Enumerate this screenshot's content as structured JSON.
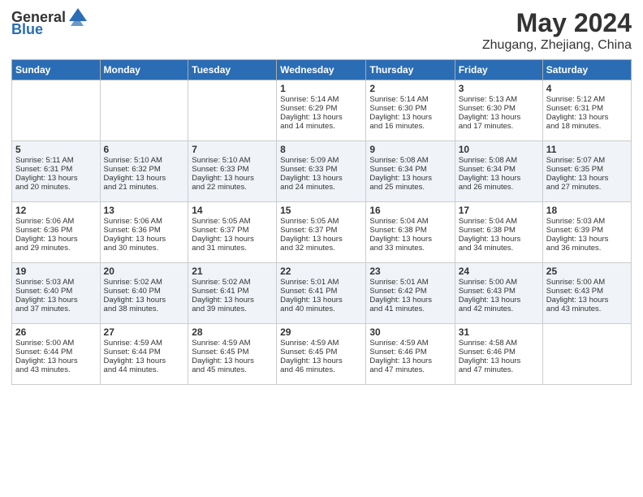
{
  "logo": {
    "general": "General",
    "blue": "Blue"
  },
  "title": {
    "month_year": "May 2024",
    "location": "Zhugang, Zhejiang, China"
  },
  "days_header": [
    "Sunday",
    "Monday",
    "Tuesday",
    "Wednesday",
    "Thursday",
    "Friday",
    "Saturday"
  ],
  "weeks": [
    {
      "cells": [
        {
          "day": "",
          "info": ""
        },
        {
          "day": "",
          "info": ""
        },
        {
          "day": "",
          "info": ""
        },
        {
          "day": "1",
          "info": "Sunrise: 5:14 AM\nSunset: 6:29 PM\nDaylight: 13 hours\nand 14 minutes."
        },
        {
          "day": "2",
          "info": "Sunrise: 5:14 AM\nSunset: 6:30 PM\nDaylight: 13 hours\nand 16 minutes."
        },
        {
          "day": "3",
          "info": "Sunrise: 5:13 AM\nSunset: 6:30 PM\nDaylight: 13 hours\nand 17 minutes."
        },
        {
          "day": "4",
          "info": "Sunrise: 5:12 AM\nSunset: 6:31 PM\nDaylight: 13 hours\nand 18 minutes."
        }
      ]
    },
    {
      "cells": [
        {
          "day": "5",
          "info": "Sunrise: 5:11 AM\nSunset: 6:31 PM\nDaylight: 13 hours\nand 20 minutes."
        },
        {
          "day": "6",
          "info": "Sunrise: 5:10 AM\nSunset: 6:32 PM\nDaylight: 13 hours\nand 21 minutes."
        },
        {
          "day": "7",
          "info": "Sunrise: 5:10 AM\nSunset: 6:33 PM\nDaylight: 13 hours\nand 22 minutes."
        },
        {
          "day": "8",
          "info": "Sunrise: 5:09 AM\nSunset: 6:33 PM\nDaylight: 13 hours\nand 24 minutes."
        },
        {
          "day": "9",
          "info": "Sunrise: 5:08 AM\nSunset: 6:34 PM\nDaylight: 13 hours\nand 25 minutes."
        },
        {
          "day": "10",
          "info": "Sunrise: 5:08 AM\nSunset: 6:34 PM\nDaylight: 13 hours\nand 26 minutes."
        },
        {
          "day": "11",
          "info": "Sunrise: 5:07 AM\nSunset: 6:35 PM\nDaylight: 13 hours\nand 27 minutes."
        }
      ]
    },
    {
      "cells": [
        {
          "day": "12",
          "info": "Sunrise: 5:06 AM\nSunset: 6:36 PM\nDaylight: 13 hours\nand 29 minutes."
        },
        {
          "day": "13",
          "info": "Sunrise: 5:06 AM\nSunset: 6:36 PM\nDaylight: 13 hours\nand 30 minutes."
        },
        {
          "day": "14",
          "info": "Sunrise: 5:05 AM\nSunset: 6:37 PM\nDaylight: 13 hours\nand 31 minutes."
        },
        {
          "day": "15",
          "info": "Sunrise: 5:05 AM\nSunset: 6:37 PM\nDaylight: 13 hours\nand 32 minutes."
        },
        {
          "day": "16",
          "info": "Sunrise: 5:04 AM\nSunset: 6:38 PM\nDaylight: 13 hours\nand 33 minutes."
        },
        {
          "day": "17",
          "info": "Sunrise: 5:04 AM\nSunset: 6:38 PM\nDaylight: 13 hours\nand 34 minutes."
        },
        {
          "day": "18",
          "info": "Sunrise: 5:03 AM\nSunset: 6:39 PM\nDaylight: 13 hours\nand 36 minutes."
        }
      ]
    },
    {
      "cells": [
        {
          "day": "19",
          "info": "Sunrise: 5:03 AM\nSunset: 6:40 PM\nDaylight: 13 hours\nand 37 minutes."
        },
        {
          "day": "20",
          "info": "Sunrise: 5:02 AM\nSunset: 6:40 PM\nDaylight: 13 hours\nand 38 minutes."
        },
        {
          "day": "21",
          "info": "Sunrise: 5:02 AM\nSunset: 6:41 PM\nDaylight: 13 hours\nand 39 minutes."
        },
        {
          "day": "22",
          "info": "Sunrise: 5:01 AM\nSunset: 6:41 PM\nDaylight: 13 hours\nand 40 minutes."
        },
        {
          "day": "23",
          "info": "Sunrise: 5:01 AM\nSunset: 6:42 PM\nDaylight: 13 hours\nand 41 minutes."
        },
        {
          "day": "24",
          "info": "Sunrise: 5:00 AM\nSunset: 6:43 PM\nDaylight: 13 hours\nand 42 minutes."
        },
        {
          "day": "25",
          "info": "Sunrise: 5:00 AM\nSunset: 6:43 PM\nDaylight: 13 hours\nand 43 minutes."
        }
      ]
    },
    {
      "cells": [
        {
          "day": "26",
          "info": "Sunrise: 5:00 AM\nSunset: 6:44 PM\nDaylight: 13 hours\nand 43 minutes."
        },
        {
          "day": "27",
          "info": "Sunrise: 4:59 AM\nSunset: 6:44 PM\nDaylight: 13 hours\nand 44 minutes."
        },
        {
          "day": "28",
          "info": "Sunrise: 4:59 AM\nSunset: 6:45 PM\nDaylight: 13 hours\nand 45 minutes."
        },
        {
          "day": "29",
          "info": "Sunrise: 4:59 AM\nSunset: 6:45 PM\nDaylight: 13 hours\nand 46 minutes."
        },
        {
          "day": "30",
          "info": "Sunrise: 4:59 AM\nSunset: 6:46 PM\nDaylight: 13 hours\nand 47 minutes."
        },
        {
          "day": "31",
          "info": "Sunrise: 4:58 AM\nSunset: 6:46 PM\nDaylight: 13 hours\nand 47 minutes."
        },
        {
          "day": "",
          "info": ""
        }
      ]
    }
  ]
}
